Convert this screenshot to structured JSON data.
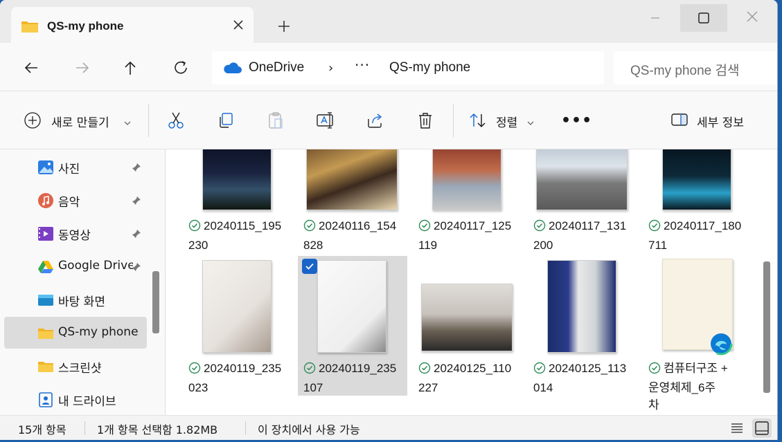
{
  "tab": {
    "title": "QS-my phone",
    "icon": "folder-icon"
  },
  "address": {
    "crumbs": [
      "OneDrive",
      "QS-my phone"
    ],
    "separator": "›",
    "more": "···"
  },
  "search": {
    "placeholder": "QS-my phone 검색"
  },
  "toolbar": {
    "new_label": "새로 만들기",
    "sort_label": "정렬",
    "more_label": "•••",
    "details_label": "세부 정보"
  },
  "sidebar": {
    "items": [
      {
        "label": "사진",
        "icon": "photos-icon",
        "pinned": true
      },
      {
        "label": "음악",
        "icon": "music-icon",
        "pinned": true
      },
      {
        "label": "동영상",
        "icon": "videos-icon",
        "pinned": true
      },
      {
        "label": "Google Drive",
        "icon": "google-drive-icon",
        "pinned": true
      },
      {
        "label": "바탕 화면",
        "icon": "desktop-icon",
        "pinned": false
      },
      {
        "label": "QS-my phone",
        "icon": "folder-icon",
        "pinned": false,
        "selected": true
      },
      {
        "label": "스크린샷",
        "icon": "folder-icon",
        "pinned": false
      },
      {
        "label": "내 드라이브",
        "icon": "drive-icon",
        "pinned": false
      }
    ]
  },
  "files": [
    {
      "line1": "20240115_195",
      "line2": "230"
    },
    {
      "line1": "20240116_154",
      "line2": "828"
    },
    {
      "line1": "20240117_125",
      "line2": "119"
    },
    {
      "line1": "20240117_131",
      "line2": "200"
    },
    {
      "line1": "20240117_180",
      "line2": "711"
    },
    {
      "line1": "20240119_235",
      "line2": "023"
    },
    {
      "line1": "20240119_235",
      "line2": "107",
      "selected": true
    },
    {
      "line1": "20240125_110",
      "line2": "227"
    },
    {
      "line1": "20240125_113",
      "line2": "014"
    },
    {
      "line1": "컴퓨터구조 +",
      "line2": "운영체제_6주",
      "line3": "차"
    }
  ],
  "status": {
    "count": "15개 항목",
    "selection": "1개 항목 선택함 1.82MB",
    "availability": "이 장치에서 사용 가능"
  },
  "colors": {
    "accent": "#1a64c8",
    "sync_green": "#2e8b57",
    "folder": "#f5c342"
  }
}
